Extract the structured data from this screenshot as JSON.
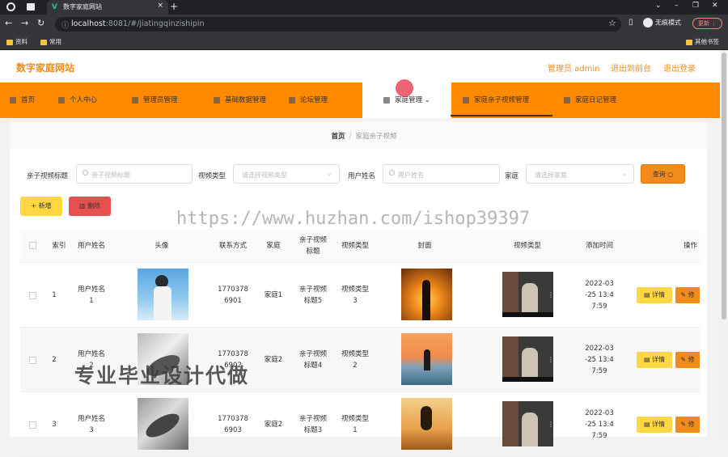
{
  "browser": {
    "tab_title": "数字家庭网站",
    "url_host": "localhost",
    "url_rest": ":8081/#/jiatingqinzishipin",
    "incognito_label": "无痕模式",
    "update_label": "更新",
    "bookmarks": [
      "资料",
      "常用"
    ],
    "other_bookmarks": "其他书签"
  },
  "header": {
    "site_title": "数字家庭网站",
    "admin_label": "管理员 admin",
    "back_label": "退出到前台",
    "logout_label": "退出登录"
  },
  "menu": [
    {
      "label": "首页"
    },
    {
      "label": "个人中心"
    },
    {
      "label": "管理员管理"
    },
    {
      "label": "基础数据管理"
    },
    {
      "label": "论坛管理"
    },
    {
      "label": "家庭管理"
    },
    {
      "label": "家庭亲子视频管理"
    },
    {
      "label": "家庭日记管理"
    }
  ],
  "menu_active_chevron": "⌄",
  "breadcrumb": {
    "home": "首页",
    "sep": "/",
    "current": "家庭亲子视频"
  },
  "filters": {
    "title_label": "亲子视频标题",
    "title_placeholder": "亲子视频标题",
    "type_label": "视频类型",
    "type_placeholder": "请选择视频类型",
    "user_label": "用户姓名",
    "user_placeholder": "用户姓名",
    "family_label": "家庭",
    "family_placeholder": "请选择家庭",
    "search_button": "查询"
  },
  "actions": {
    "add": "+ 新增",
    "delete": "删除"
  },
  "watermark": "https://www.huzhan.com/ishop39397",
  "watermark2": "专业毕业设计代做",
  "table": {
    "headers": [
      "索引",
      "用户姓名",
      "头像",
      "联系方式",
      "家庭",
      "亲子视频\n标题",
      "视频类型",
      "封面",
      "视频类型",
      "添加时间",
      "操作"
    ],
    "rows": [
      {
        "index": "1",
        "user": "用户姓名\n1",
        "phone": "1770378\n6901",
        "family": "家庭1",
        "title": "亲子视频\n标题5",
        "vtype": "视频类型\n3",
        "time": "2022-03\n-25 13:4\n7:59",
        "detail": "详情",
        "edit": "修"
      },
      {
        "index": "2",
        "user": "用户姓名\n2",
        "phone": "1770378\n6902",
        "family": "家庭2",
        "title": "亲子视频\n标题4",
        "vtype": "视频类型\n2",
        "time": "2022-03\n-25 13:4\n7:59",
        "detail": "详情",
        "edit": "修"
      },
      {
        "index": "3",
        "user": "用户姓名\n3",
        "phone": "1770378\n6903",
        "family": "家庭2",
        "title": "亲子视频\n标题3",
        "vtype": "视频类型\n1",
        "time": "2022-03\n-25 13:4\n7:59",
        "detail": "详情",
        "edit": "修"
      }
    ]
  },
  "colors": {
    "accent": "#ff8a00",
    "title": "#f28b1a",
    "yellow": "#ffd740",
    "red": "#e85050"
  }
}
